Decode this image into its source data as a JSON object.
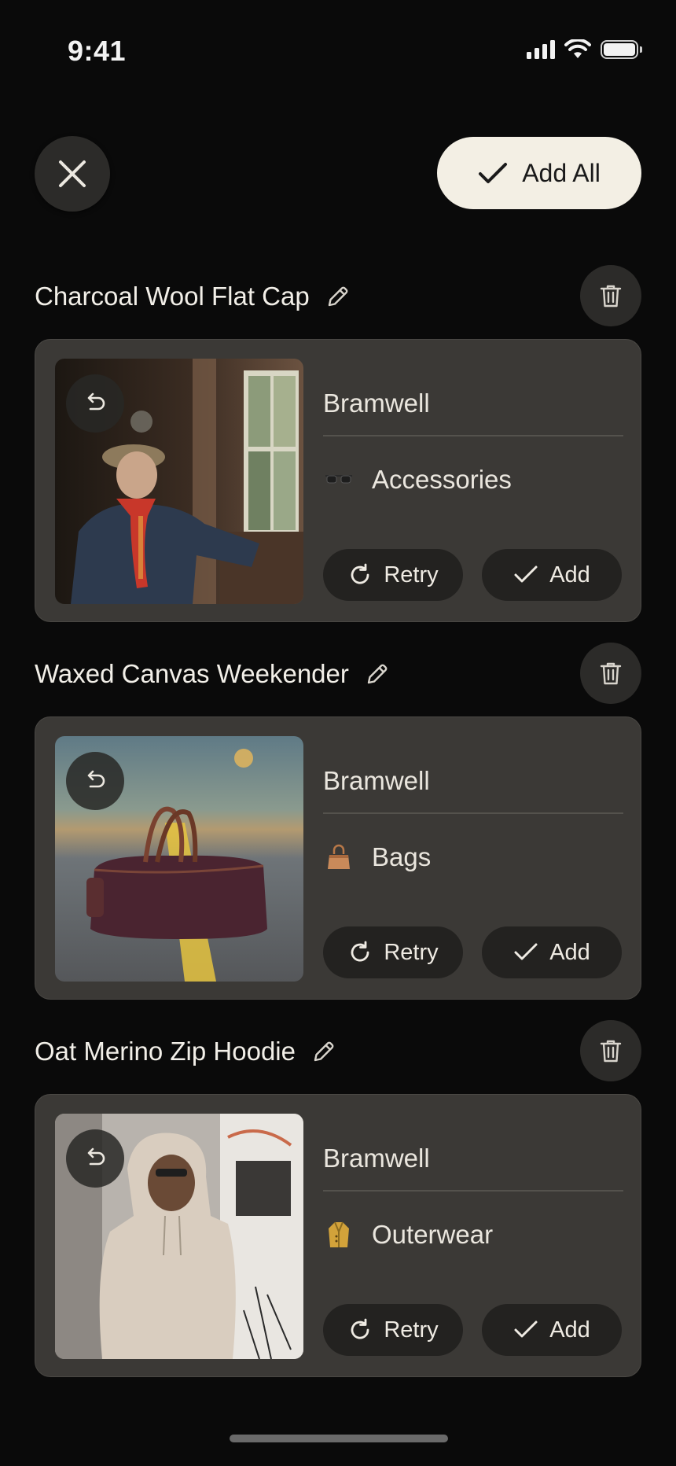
{
  "status": {
    "time": "9:41"
  },
  "header": {
    "add_all_label": "Add All"
  },
  "items": [
    {
      "title": "Charcoal Wool Flat Cap",
      "brand": "Bramwell",
      "category": "Accessories",
      "category_icon": "sunglasses-icon",
      "retry_label": "Retry",
      "add_label": "Add"
    },
    {
      "title": "Waxed Canvas Weekender",
      "brand": "Bramwell",
      "category": "Bags",
      "category_icon": "handbag-icon",
      "retry_label": "Retry",
      "add_label": "Add"
    },
    {
      "title": "Oat Merino Zip Hoodie",
      "brand": "Bramwell",
      "category": "Outerwear",
      "category_icon": "coat-icon",
      "retry_label": "Retry",
      "add_label": "Add"
    }
  ],
  "colors": {
    "background": "#0a0a0a",
    "card": "#3b3936",
    "accent_button": "#f3efe4"
  }
}
